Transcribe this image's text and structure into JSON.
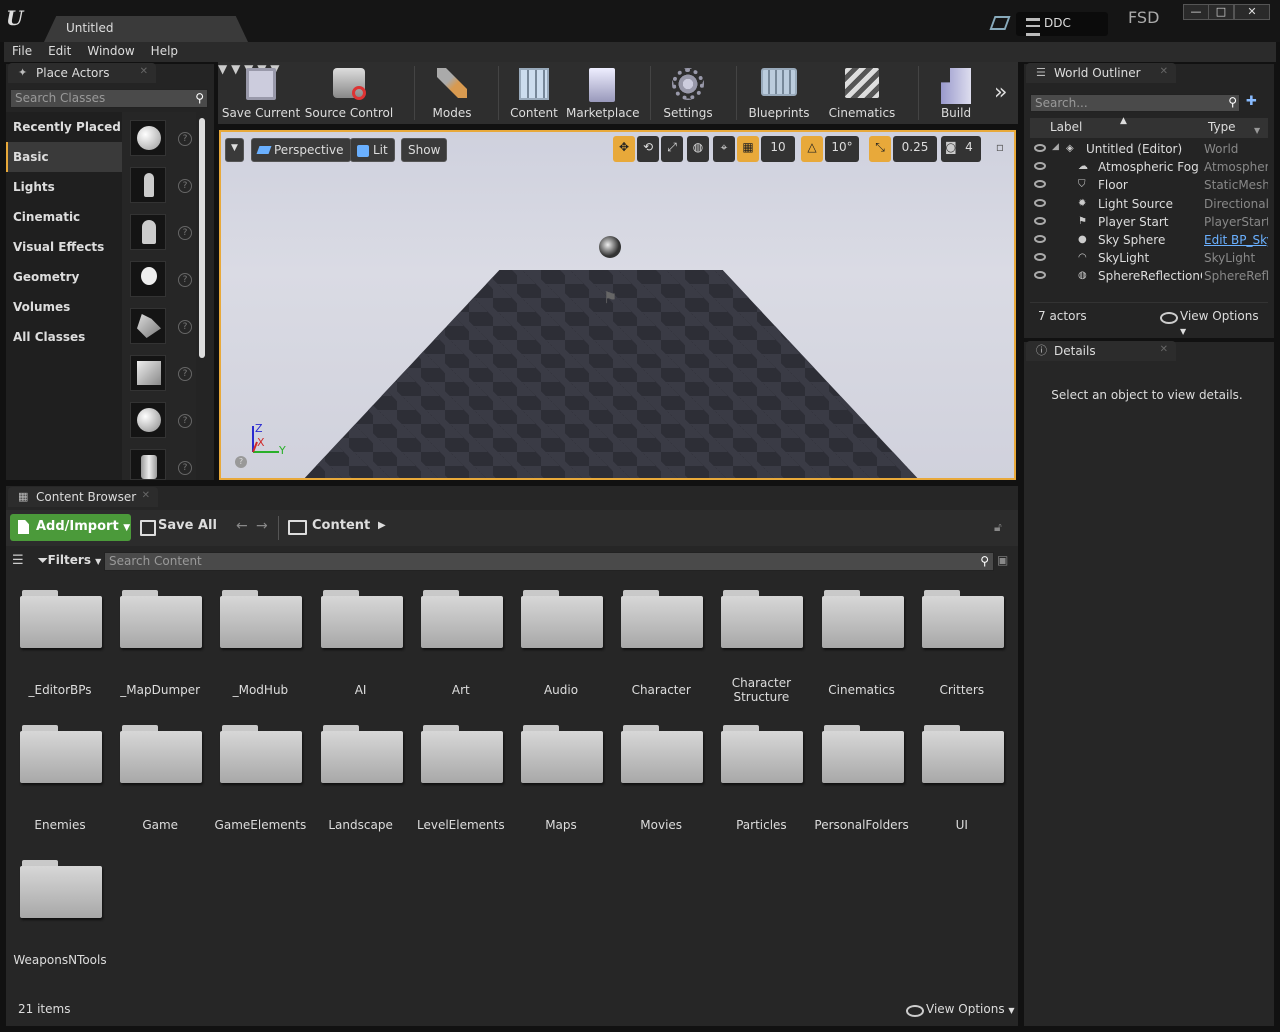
{
  "window": {
    "tab_title": "Untitled",
    "ddc_label": "DDC",
    "project_label": "FSD",
    "min_glyph": "—",
    "max_glyph": "□",
    "close_glyph": "✕"
  },
  "menu": [
    "File",
    "Edit",
    "Window",
    "Help"
  ],
  "place_actors": {
    "title": "Place Actors",
    "search_placeholder": "Search Classes",
    "categories": [
      "Recently Placed",
      "Basic",
      "Lights",
      "Cinematic",
      "Visual Effects",
      "Geometry",
      "Volumes",
      "All Classes"
    ],
    "active_category": "Basic",
    "item_icons": [
      "sphere-icon",
      "mannequin-icon",
      "player-start-icon",
      "point-light-icon",
      "trigger-icon",
      "cube-icon",
      "sphere-icon",
      "cylinder-icon"
    ]
  },
  "toolbar": {
    "items": [
      {
        "label": "Save Current",
        "icon": "save-icon"
      },
      {
        "label": "Source Control",
        "icon": "source-control-icon"
      },
      {
        "label": "Modes",
        "icon": "modes-icon"
      },
      {
        "label": "Content",
        "icon": "content-icon"
      },
      {
        "label": "Marketplace",
        "icon": "marketplace-icon"
      },
      {
        "label": "Settings",
        "icon": "settings-icon"
      },
      {
        "label": "Blueprints",
        "icon": "blueprints-icon"
      },
      {
        "label": "Cinematics",
        "icon": "cinematics-icon"
      },
      {
        "label": "Build",
        "icon": "build-icon"
      }
    ],
    "overflow_glyph": "»"
  },
  "viewport": {
    "perspective_label": "Perspective",
    "lit_label": "Lit",
    "show_label": "Show",
    "grid_snap": "10",
    "rotation_snap": "10°",
    "scale_snap": "0.25",
    "camera_speed": "4",
    "axis_z": "Z",
    "axis_x": "X",
    "axis_y": "Y"
  },
  "content_browser": {
    "title": "Content Browser",
    "add_import_label": "Add/Import",
    "save_all_label": "Save All",
    "breadcrumb": "Content",
    "filters_label": "Filters",
    "search_placeholder": "Search Content",
    "folders": [
      "_EditorBPs",
      "_MapDumper",
      "_ModHub",
      "AI",
      "Art",
      "Audio",
      "Character",
      "Character Structure",
      "Cinematics",
      "Critters",
      "Enemies",
      "Game",
      "GameElements",
      "Landscape",
      "LevelElements",
      "Maps",
      "Movies",
      "Particles",
      "PersonalFolders",
      "UI",
      "WeaponsNTools"
    ],
    "item_count": "21 items",
    "view_options_label": "View Options"
  },
  "world_outliner": {
    "title": "World Outliner",
    "search_placeholder": "Search...",
    "col_label": "Label",
    "col_type": "Type",
    "rows": [
      {
        "label": "Untitled (Editor)",
        "type": "World",
        "icon": "world-icon"
      },
      {
        "label": "Atmospheric Fog",
        "type": "AtmosphericFog",
        "icon": "fog-icon"
      },
      {
        "label": "Floor",
        "type": "StaticMeshActor",
        "icon": "mesh-icon"
      },
      {
        "label": "Light Source",
        "type": "DirectionalLight",
        "icon": "light-icon"
      },
      {
        "label": "Player Start",
        "type": "PlayerStart",
        "icon": "player-start-icon"
      },
      {
        "label": "Sky Sphere",
        "type": "Edit BP_Sky",
        "icon": "sky-sphere-icon"
      },
      {
        "label": "SkyLight",
        "type": "SkyLight",
        "icon": "skylight-icon"
      },
      {
        "label": "SphereReflectionCapture",
        "type": "SphereReflectionCapture",
        "icon": "reflection-icon"
      }
    ],
    "actor_count": "7 actors",
    "view_options_label": "View Options"
  },
  "details": {
    "title": "Details",
    "empty_message": "Select an object to view details."
  }
}
